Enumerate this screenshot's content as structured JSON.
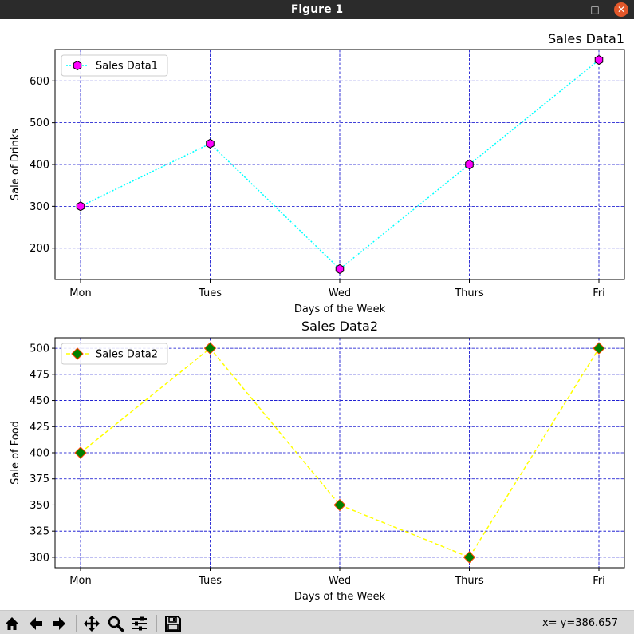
{
  "window": {
    "title": "Figure 1"
  },
  "chart_data": [
    {
      "type": "line",
      "title": "Sales Data1",
      "title_align": "right",
      "xlabel": "Days of the Week",
      "ylabel": "Sale of Drinks",
      "categories": [
        "Mon",
        "Tues",
        "Wed",
        "Thurs",
        "Fri"
      ],
      "ylim": [
        125,
        675
      ],
      "yticks": [
        200,
        300,
        400,
        500,
        600
      ],
      "grid": true,
      "grid_color": "#0000cc",
      "legend_position": "upper left",
      "series": [
        {
          "name": "Sales Data1",
          "values": [
            300,
            450,
            150,
            400,
            650
          ],
          "line_color": "#00ffff",
          "line_style": "dotted",
          "marker": "hexagon",
          "marker_face": "#ff00ff",
          "marker_edge": "#000000"
        }
      ]
    },
    {
      "type": "line",
      "title": "Sales Data2",
      "title_align": "center",
      "xlabel": "Days of the Week",
      "ylabel": "Sale of Food",
      "categories": [
        "Mon",
        "Tues",
        "Wed",
        "Thurs",
        "Fri"
      ],
      "ylim": [
        290,
        510
      ],
      "yticks": [
        300,
        325,
        350,
        375,
        400,
        425,
        450,
        475,
        500
      ],
      "grid": true,
      "grid_color": "#0000cc",
      "legend_position": "upper left",
      "series": [
        {
          "name": "Sales Data2",
          "values": [
            400,
            500,
            350,
            300,
            500
          ],
          "line_color": "#ffff00",
          "line_style": "dashed",
          "marker": "diamond",
          "marker_face": "#008000",
          "marker_edge": "#ff4500"
        }
      ]
    }
  ],
  "toolbar": {
    "buttons": [
      "home-icon",
      "back-arrow-icon",
      "forward-arrow-icon",
      "pan-icon",
      "zoom-icon",
      "configure-subplots-icon",
      "save-icon"
    ],
    "coords_text": "x= y=386.657"
  }
}
